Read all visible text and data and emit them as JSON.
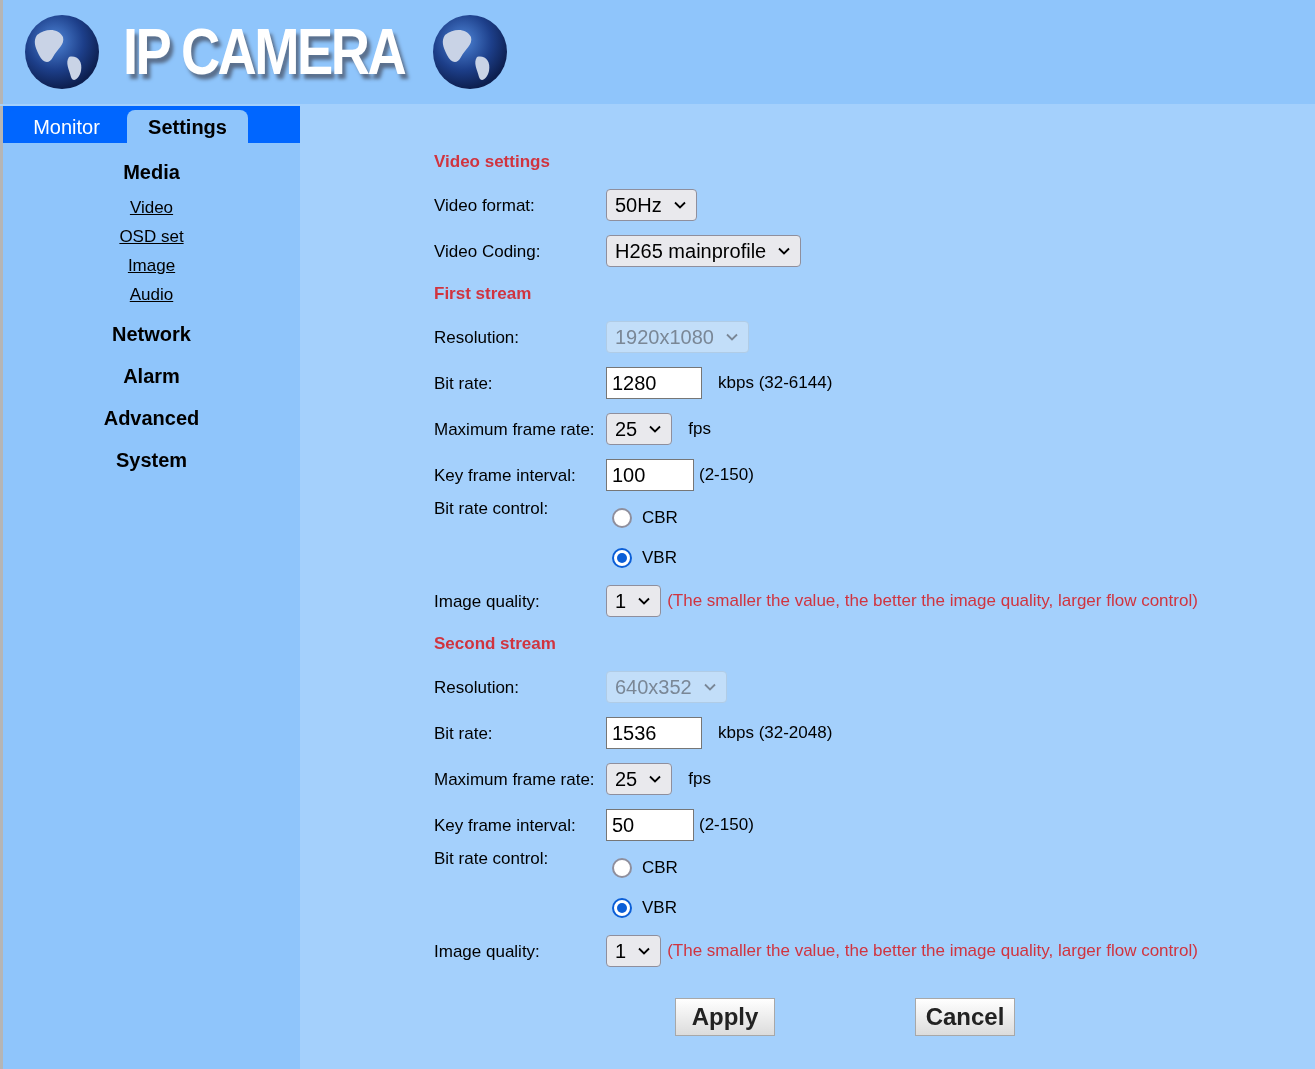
{
  "header": {
    "logo_text": "IP CAMERA"
  },
  "tabs": [
    {
      "label": "Monitor",
      "selected": false
    },
    {
      "label": "Settings",
      "selected": true
    }
  ],
  "sidebar": {
    "items": [
      {
        "label": "Media",
        "children": [
          {
            "label": "Video"
          },
          {
            "label": "OSD set"
          },
          {
            "label": "Image"
          },
          {
            "label": "Audio"
          }
        ]
      },
      {
        "label": "Network"
      },
      {
        "label": "Alarm"
      },
      {
        "label": "Advanced"
      },
      {
        "label": "System"
      }
    ]
  },
  "form": {
    "rows": [
      {
        "kind": "heading",
        "label": "Video settings"
      },
      {
        "kind": "select",
        "label": "Video format:",
        "value": "50Hz",
        "disabled": false
      },
      {
        "kind": "select",
        "label": "Video Coding:",
        "value": "H265 mainprofile",
        "disabled": false
      },
      {
        "kind": "heading",
        "label": "First stream"
      },
      {
        "kind": "select",
        "label": "Resolution:",
        "value": "1920x1080",
        "disabled": true
      },
      {
        "kind": "input",
        "label": "Bit rate:",
        "value": "1280",
        "unit": "kbps (32-6144)"
      },
      {
        "kind": "select",
        "label": "Maximum frame rate:",
        "value": "25",
        "disabled": false,
        "unit": "fps"
      },
      {
        "kind": "input",
        "label": "Key frame interval:",
        "value": "100",
        "range": "(2-150)"
      },
      {
        "kind": "radio",
        "label": "Bit rate control:",
        "options": [
          {
            "label": "CBR",
            "selected": false
          },
          {
            "label": "VBR",
            "selected": true
          }
        ]
      },
      {
        "kind": "select",
        "label": "Image quality:",
        "value": "1",
        "disabled": false,
        "hint": "(The smaller the value, the better the image quality, larger flow control)"
      },
      {
        "kind": "heading",
        "label": "Second stream"
      },
      {
        "kind": "select",
        "label": "Resolution:",
        "value": "640x352",
        "disabled": true
      },
      {
        "kind": "input",
        "label": "Bit rate:",
        "value": "1536",
        "unit": "kbps (32-2048)"
      },
      {
        "kind": "select",
        "label": "Maximum frame rate:",
        "value": "25",
        "disabled": false,
        "unit": "fps"
      },
      {
        "kind": "input",
        "label": "Key frame interval:",
        "value": "50",
        "range": "(2-150)"
      },
      {
        "kind": "radio",
        "label": "Bit rate control:",
        "options": [
          {
            "label": "CBR",
            "selected": false
          },
          {
            "label": "VBR",
            "selected": true
          }
        ]
      },
      {
        "kind": "select",
        "label": "Image quality:",
        "value": "1",
        "disabled": false,
        "hint": "(The smaller the value, the better the image quality, larger flow control)"
      }
    ]
  },
  "buttons": [
    "Apply",
    "Cancel"
  ]
}
